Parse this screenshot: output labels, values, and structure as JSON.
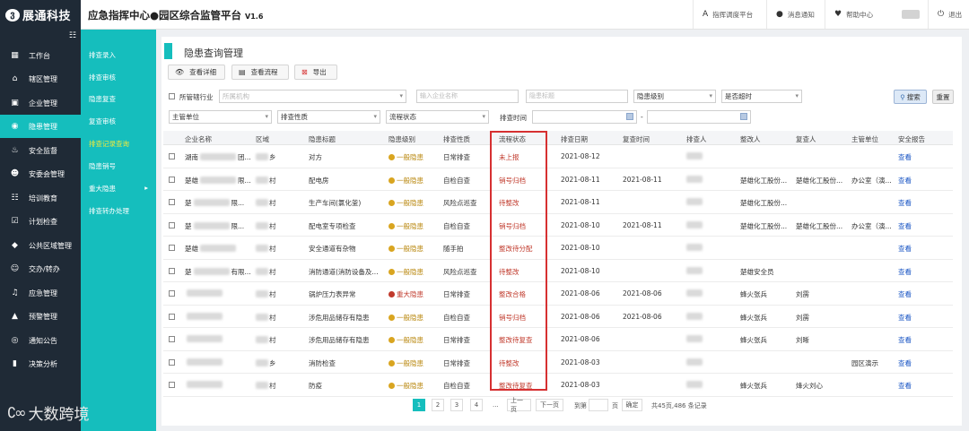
{
  "app": {
    "logo_text": "展通科技",
    "title": "应急指挥中心●园区综合监管平台",
    "version": "V1.6"
  },
  "top_nav": [
    {
      "icon": "font-icon",
      "label": "指挥调度平台"
    },
    {
      "icon": "chat-icon",
      "label": "消息通知"
    },
    {
      "icon": "heart-icon",
      "label": "帮助中心"
    },
    {
      "icon": "logout-icon",
      "label": "退出"
    }
  ],
  "sidebar": {
    "items": [
      {
        "icon": "windows-icon",
        "label": "工作台"
      },
      {
        "icon": "home-icon",
        "label": "辖区管理"
      },
      {
        "icon": "briefcase-icon",
        "label": "企业管理"
      },
      {
        "icon": "radio-icon",
        "label": "隐患管理"
      },
      {
        "icon": "fire-icon",
        "label": "安全监督"
      },
      {
        "icon": "user-icon",
        "label": "安委会管理"
      },
      {
        "icon": "group-icon",
        "label": "培训教育"
      },
      {
        "icon": "check-icon",
        "label": "计划检查"
      },
      {
        "icon": "cube-icon",
        "label": "公共区域管理"
      },
      {
        "icon": "users-icon",
        "label": "交办/转办"
      },
      {
        "icon": "bell-icon",
        "label": "应急管理"
      },
      {
        "icon": "warning-icon",
        "label": "预警管理"
      },
      {
        "icon": "broadcast-icon",
        "label": "通知公告"
      },
      {
        "icon": "bar-chart-icon",
        "label": "决策分析"
      }
    ]
  },
  "submenu": [
    {
      "label": "排查录入"
    },
    {
      "label": "排查审核"
    },
    {
      "label": "隐患复查"
    },
    {
      "label": "复查审核"
    },
    {
      "label": "排查记录查询"
    },
    {
      "label": "隐患销号"
    },
    {
      "label": "重大隐患",
      "arrow": "▸"
    },
    {
      "label": "排查转办处理"
    }
  ],
  "watermark": "大数跨境",
  "page": {
    "title": "隐患查询管理"
  },
  "toolbar": {
    "view_detail": "查看详细",
    "view_process": "查看流程",
    "export": "导出"
  },
  "filters": {
    "jurisdiction_label": "所管辖行业",
    "org_placeholder": "所属机构",
    "company_placeholder": "输入企业名称",
    "title_placeholder": "隐患标题",
    "level": "隐患级别",
    "overdue": "是否超时",
    "dept": "主管单位",
    "nature": "排查性质",
    "status": "流程状态",
    "time_label": "排查时间",
    "time_sep": "-",
    "search": "搜索",
    "reset": "重置"
  },
  "table": {
    "headers": [
      "企业名称",
      "区域",
      "隐患标题",
      "隐患级别",
      "排查性质",
      "流程状态",
      "排查日期",
      "复查时间",
      "排查人",
      "整改人",
      "复查人",
      "主管单位",
      "安全报告"
    ],
    "rows": [
      {
        "company": "湖南",
        "company_suffix": "团...",
        "area": "乡",
        "title": "对方",
        "level": "一般隐患",
        "nature": "日常排查",
        "status": "未上报",
        "date": "2021-08-12",
        "review": "",
        "inspector": "",
        "rectifier": "",
        "reviewer": "",
        "dept": "",
        "report": "查看"
      },
      {
        "company": "楚雄",
        "company_suffix": "限...",
        "area": "村",
        "title": "配电房",
        "level": "一般隐患",
        "nature": "自检自查",
        "status": "销号归档",
        "date": "2021-08-11",
        "review": "2021-08-11",
        "inspector": "",
        "rectifier": "楚雄化工股份...",
        "reviewer": "楚雄化工股份...",
        "dept": "办公室（演...",
        "report": "查看"
      },
      {
        "company": "楚",
        "company_suffix": "限...",
        "area": "村",
        "title": "生产车间(氯化釜)",
        "level": "一般隐患",
        "nature": "风险点巡查",
        "status": "待整改",
        "date": "2021-08-11",
        "review": "",
        "inspector": "",
        "rectifier": "楚雄化工股份...",
        "reviewer": "",
        "dept": "",
        "report": "查看"
      },
      {
        "company": "楚",
        "company_suffix": "限...",
        "area": "村",
        "title": "配电室专项检查",
        "level": "一般隐患",
        "nature": "自检自查",
        "status": "销号归档",
        "date": "2021-08-10",
        "review": "2021-08-11",
        "inspector": "",
        "rectifier": "楚雄化工股份...",
        "reviewer": "楚雄化工股份...",
        "dept": "办公室（演...",
        "report": "查看"
      },
      {
        "company": "楚雄",
        "company_suffix": "",
        "area": "村",
        "title": "安全通道有杂物",
        "level": "一般隐患",
        "nature": "随手拍",
        "status": "整改待分配",
        "date": "2021-08-10",
        "review": "",
        "inspector": "",
        "rectifier": "",
        "reviewer": "",
        "dept": "",
        "report": "查看"
      },
      {
        "company": "楚",
        "company_suffix": "有限...",
        "area": "村",
        "title": "消防通道(消防设备及...",
        "level": "一般隐患",
        "nature": "风险点巡查",
        "status": "待整改",
        "date": "2021-08-10",
        "review": "",
        "inspector": "",
        "rectifier": "楚雄安全员",
        "reviewer": "",
        "dept": "",
        "report": "查看"
      },
      {
        "company": "",
        "company_suffix": "",
        "area": "村",
        "title": "锅炉压力表异常",
        "level": "重大隐患",
        "nature": "日常排查",
        "status": "整改合格",
        "date": "2021-08-06",
        "review": "2021-08-06",
        "inspector": "",
        "rectifier": "蜂火张兵",
        "reviewer": "刘雳",
        "dept": "",
        "report": "查看"
      },
      {
        "company": "",
        "company_suffix": "",
        "area": "村",
        "title": "涉危用品储存有隐患",
        "level": "一般隐患",
        "nature": "自检自查",
        "status": "销号归档",
        "date": "2021-08-06",
        "review": "2021-08-06",
        "inspector": "",
        "rectifier": "蜂火张兵",
        "reviewer": "刘雳",
        "dept": "",
        "report": "查看"
      },
      {
        "company": "",
        "company_suffix": "",
        "area": "村",
        "title": "涉危用品储存有隐患",
        "level": "一般隐患",
        "nature": "日常排查",
        "status": "整改待复查",
        "date": "2021-08-06",
        "review": "",
        "inspector": "",
        "rectifier": "蜂火张兵",
        "reviewer": "刘晰",
        "dept": "",
        "report": "查看"
      },
      {
        "company": "",
        "company_suffix": "",
        "area": "乡",
        "title": "消防检查",
        "level": "一般隐患",
        "nature": "日常排查",
        "status": "待整改",
        "date": "2021-08-03",
        "review": "",
        "inspector": "",
        "rectifier": "",
        "reviewer": "",
        "dept": "园区演示",
        "report": "查看"
      },
      {
        "company": "",
        "company_suffix": "",
        "area": "村",
        "title": "防疫",
        "level": "一般隐患",
        "nature": "自检自查",
        "status": "整改待复查",
        "date": "2021-08-03",
        "review": "",
        "inspector": "",
        "rectifier": "蜂火张兵",
        "reviewer": "烽火刘心",
        "dept": "",
        "report": "查看"
      }
    ]
  },
  "pagination": {
    "pages": [
      "1",
      "2",
      "3",
      "4"
    ],
    "ellipsis": "...",
    "prev": "上一页",
    "next": "下一页",
    "goto": "到第",
    "page_unit": "页",
    "confirm": "确定",
    "total": "共45页,486 条记录"
  },
  "colors": {
    "teal": "#15bebd",
    "sidebar": "#1f2a36",
    "highlight_box": "#d63031"
  }
}
